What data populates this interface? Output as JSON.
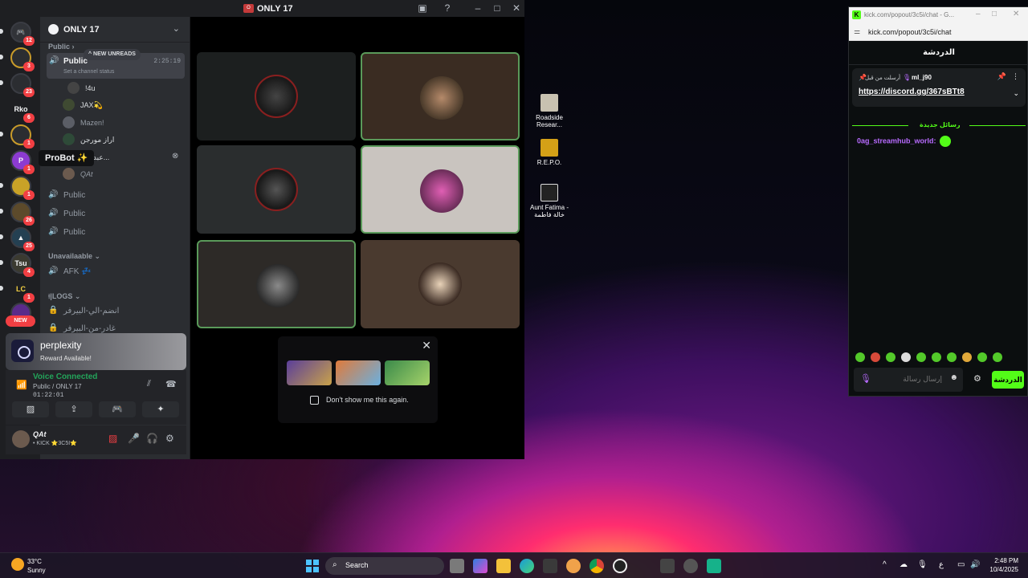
{
  "discord": {
    "window_title": "ONLY 17",
    "server_name": "ONLY 17",
    "guild_badges": [
      "12",
      "3",
      "23",
      "6",
      "1",
      "1",
      "1",
      "26",
      "25",
      "4",
      "1"
    ],
    "guild_labels": [
      "",
      "",
      "",
      "Rko",
      "",
      "",
      "",
      "",
      "",
      "Tsu",
      "LC"
    ],
    "guild_new": "NEW",
    "tooltip": "ProBot ✨",
    "categories": {
      "public": "Public",
      "unavailable": "Unavailaable",
      "logs": "LOGS"
    },
    "active_channel": {
      "name": "Public",
      "timer": "2:25:19",
      "status": "Set a channel status"
    },
    "new_unreads": "NEW UNREADS",
    "members": [
      "!4u",
      "JAX💫",
      "Mazen!",
      "اراز مورجن",
      "عبدالـ...",
      "QAt"
    ],
    "voice_channels": [
      "Public",
      "Public",
      "Public"
    ],
    "afk_channel": "AFK 💤",
    "locked_channels": [
      "انضم-الي-البيرفر",
      "غادر-من-البيرفر"
    ],
    "promo": {
      "title": "perplexity",
      "subtitle": "Reward Available!"
    },
    "voice_connected": {
      "title": "Voice Connected",
      "channel": "Public  /  ONLY 17",
      "elapsed": "01:22:01"
    },
    "user": {
      "name": "QAt",
      "status": "• KICK ⭐3C5I⭐"
    },
    "popup": {
      "checkbox_label": "Don't show me this again."
    }
  },
  "desktop_icons": [
    {
      "label": "Roadside Resear..."
    },
    {
      "label": "R.E.P.O."
    },
    {
      "label": "Aunt Fatima - خالة فاطمة"
    }
  ],
  "kick": {
    "tab_title": "kick.com/popout/3c5i/chat - G...",
    "url": "kick.com/popout/3c5i/chat",
    "header": "الدردشة",
    "pinned_by_label": "أرسلت من قبل",
    "pinned_user": "ml_j90",
    "pinned_link": "https://discord.gg/367sBTt8",
    "new_messages_label": "رسائل جديدة",
    "message_user": "0ag_streamhub_world:",
    "input_placeholder": "إرسال رسالة",
    "chat_button": "الدردشة"
  },
  "taskbar": {
    "temperature": "33°C",
    "weather": "Sunny",
    "search_label": "Search",
    "time": "2:48 PM",
    "date": "10/4/2025",
    "lang": "ع"
  }
}
